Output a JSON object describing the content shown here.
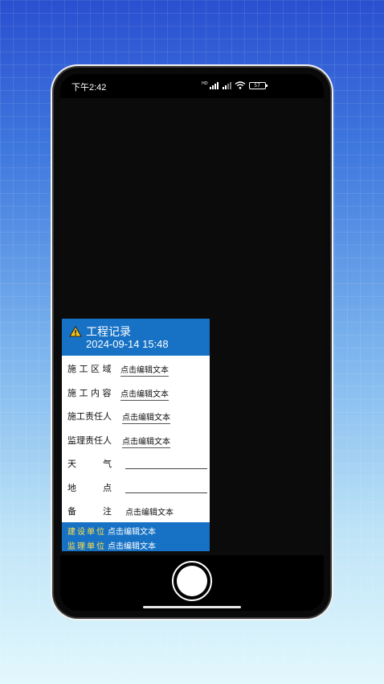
{
  "statusbar": {
    "time": "下午2:42",
    "signal_label": "HD",
    "battery": "57"
  },
  "card": {
    "title": "工程记录",
    "datetime": "2024-09-14 15:48",
    "rows": [
      {
        "label": "施 工 区 域",
        "value": "点击编辑文本"
      },
      {
        "label": "施 工 内 容",
        "value": "点击编辑文本"
      },
      {
        "label": "施工责任人",
        "value": "点击编辑文本"
      },
      {
        "label": "监理责任人",
        "value": "点击编辑文本"
      },
      {
        "label": "天　　　气",
        "value": ""
      },
      {
        "label": "地　　　点",
        "value": ""
      },
      {
        "label": "备　　　注",
        "value": "点击编辑文本"
      }
    ],
    "footer": [
      {
        "label": "建设单位",
        "value": "点击编辑文本"
      },
      {
        "label": "监理单位",
        "value": "点击编辑文本"
      }
    ]
  },
  "colors": {
    "header_blue": "#1772c5",
    "footer_label_yellow": "#ffe14a",
    "warning_icon": "#f5c518"
  },
  "icons": [
    "warning-icon",
    "signal-icon",
    "wifi-icon",
    "battery-icon"
  ]
}
